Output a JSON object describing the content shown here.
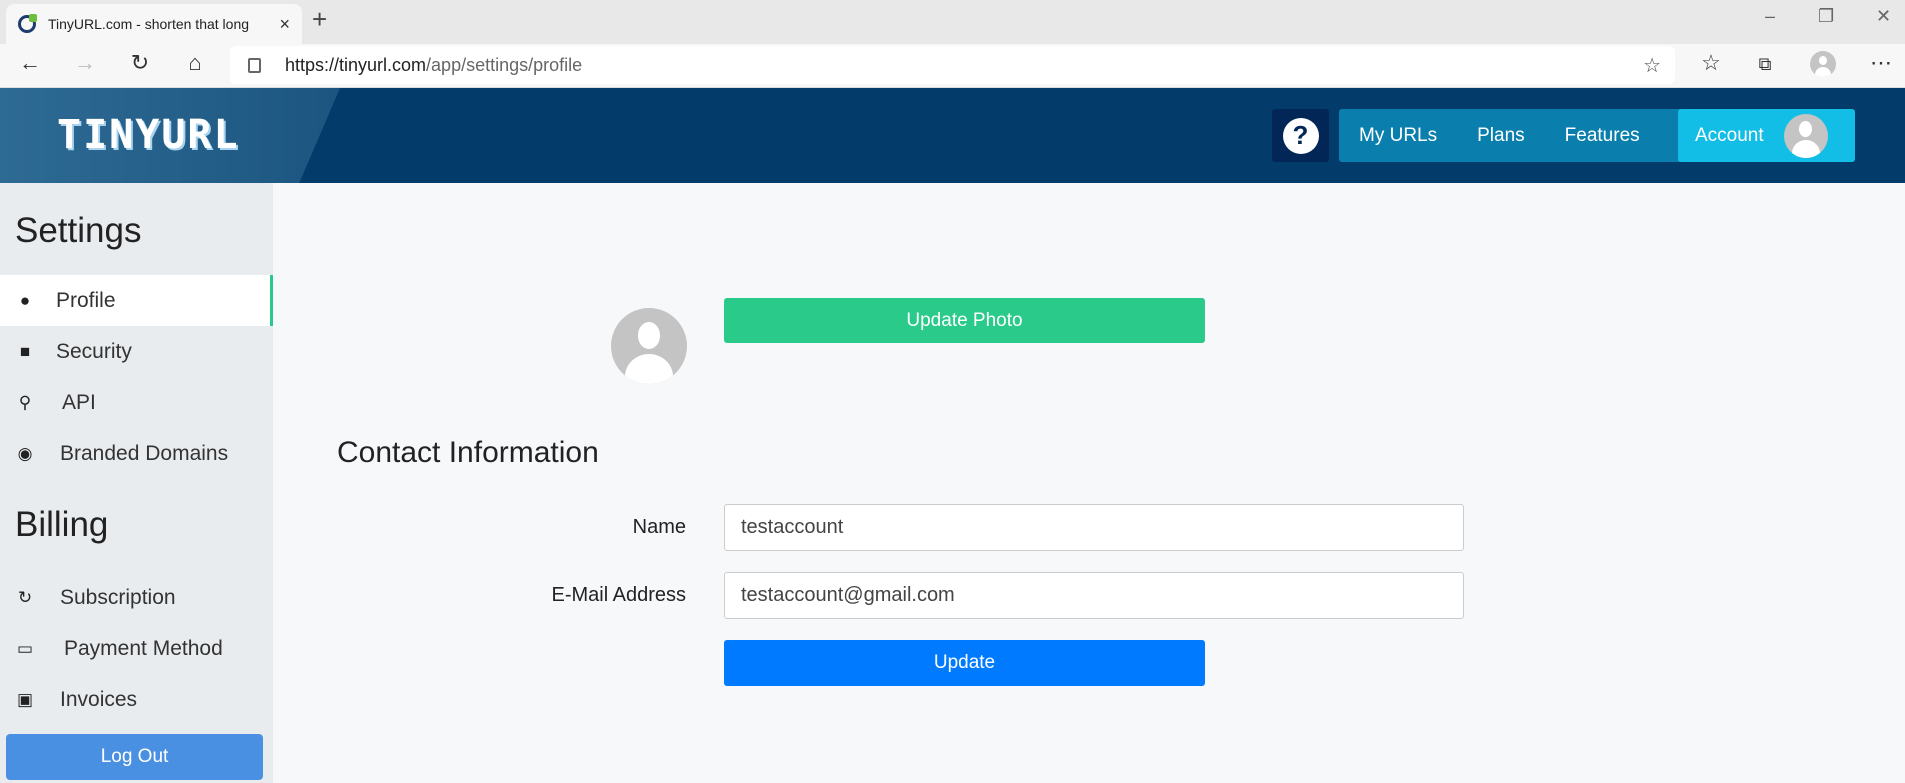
{
  "browser": {
    "tab_title": "TinyURL.com - shorten that long",
    "url_host": "https://tinyurl.com",
    "url_path": "/app/settings/profile",
    "new_tab": "+",
    "close_tab": "×"
  },
  "header": {
    "logo": "TINYURL",
    "help": "?",
    "nav": [
      "My URLs",
      "Plans",
      "Features"
    ],
    "account": "Account"
  },
  "sidebar": {
    "settings_title": "Settings",
    "settings_items": [
      {
        "label": "Profile",
        "icon": "user-icon"
      },
      {
        "label": "Security",
        "icon": "lock-icon"
      },
      {
        "label": "API",
        "icon": "key-icon"
      },
      {
        "label": "Branded Domains",
        "icon": "globe-icon"
      }
    ],
    "billing_title": "Billing",
    "billing_items": [
      {
        "label": "Subscription",
        "icon": "refresh-icon"
      },
      {
        "label": "Payment Method",
        "icon": "credit-card-icon"
      },
      {
        "label": "Invoices",
        "icon": "cart-icon"
      }
    ],
    "logout": "Log Out"
  },
  "main": {
    "update_photo": "Update Photo",
    "contact_title": "Contact Information",
    "name_label": "Name",
    "name_value": "testaccount",
    "email_label": "E-Mail Address",
    "email_value": "testaccount@gmail.com",
    "update": "Update"
  },
  "colors": {
    "header": "#033b6b",
    "green": "#2aca8a",
    "blue": "#007bff",
    "account": "#12bde6"
  }
}
